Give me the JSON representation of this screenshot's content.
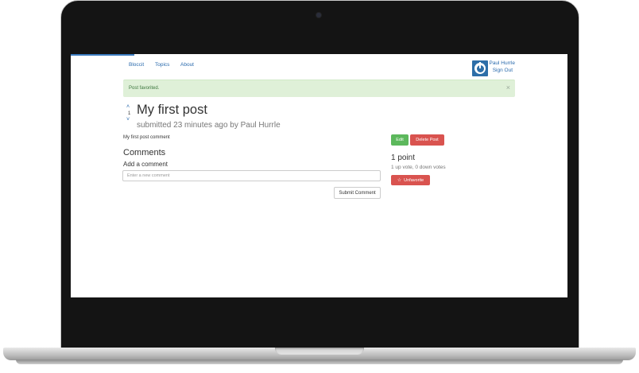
{
  "nav": {
    "brand": "Bloccit",
    "topics": "Topics",
    "about": "About"
  },
  "user": {
    "name": "Paul Hurrle",
    "sign_out": "Sign Out"
  },
  "alert": {
    "text": "Post favorited.",
    "close": "×"
  },
  "post": {
    "vote_up": "˄",
    "vote_count": "1",
    "vote_down": "˅",
    "title": "My first post",
    "meta": "submitted 23 minutes ago by Paul Hurrle",
    "body": "My first post comment"
  },
  "comments": {
    "heading": "Comments",
    "add_label": "Add a comment",
    "input_placeholder": "Enter a new comment",
    "input_value": "",
    "submit_label": "Submit Comment"
  },
  "sidebar": {
    "edit_label": "Edit",
    "delete_label": "Delete Post",
    "points": "1 point",
    "vote_summary": "1 up vote, 0 down votes",
    "star_icon": "☆",
    "unfavorite_label": "Unfavorite"
  },
  "colors": {
    "link": "#2a6aad",
    "success": "#5cb85c",
    "danger": "#d9534f",
    "alert_bg": "#dff0d8"
  }
}
